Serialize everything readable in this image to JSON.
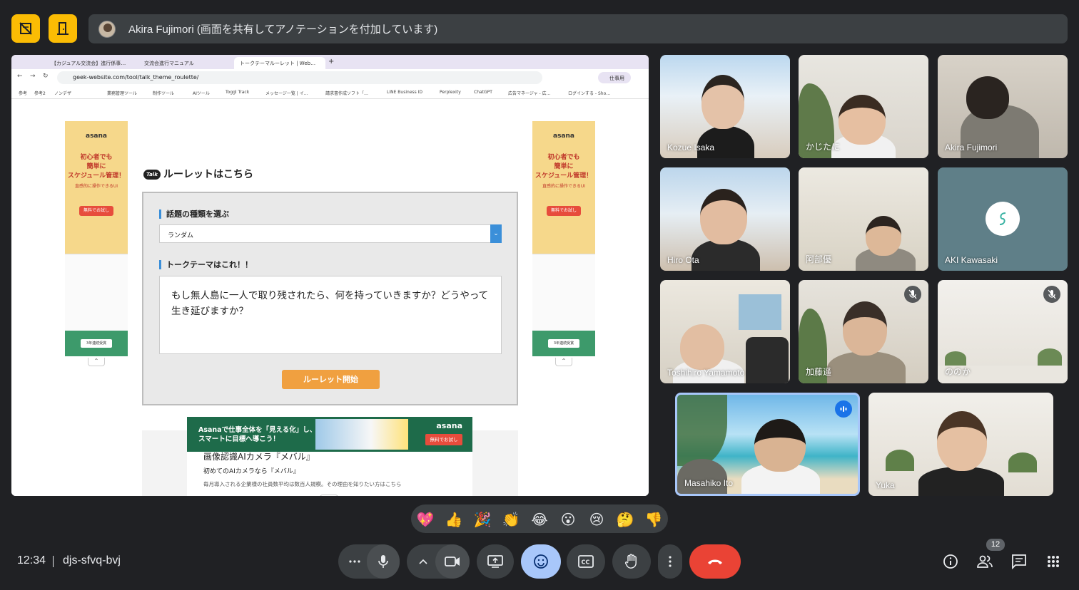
{
  "presenter": {
    "label": "Akira Fujimori (画面を共有してアノテーションを付加しています)"
  },
  "browser": {
    "tabs": [
      "【カジュアル交流会】進行係事…",
      "交流会進行マニュアル",
      "トークテーマルーレット | Web…"
    ],
    "url": "geek-website.com/tool/talk_theme_roulette/",
    "profile": "仕事用",
    "bookmarks": [
      "参考",
      "参考2",
      "ノンデザ",
      "業務管理ツール",
      "制作ツール",
      "AIツール",
      "Toggl Track",
      "メッセージ一覧 | イ…",
      "請求書作成ソフト「…",
      "LINE Business ID",
      "Perplexity",
      "ChatGPT",
      "広告マネージャ - 広…",
      "ログインする - Sho…"
    ]
  },
  "page": {
    "logo_text": "Talk",
    "title": "ルーレットはこちら",
    "topic_label": "話題の種類を選ぶ",
    "topic_value": "ランダム",
    "theme_label": "トークテーマはこれ！！",
    "theme_text": "もし無人島に一人で取り残されたら、何を持っていきますか？どうやって生き延びますか？",
    "start_button": "ルーレット開始"
  },
  "side_ad": {
    "brand": "asana",
    "headline_1": "初心者でも",
    "headline_2": "簡単に",
    "headline_3": "スケジュール管理！",
    "sub": "直感的に操作できるUI",
    "cta": "無料でお試し",
    "badge": "3年連続受賞"
  },
  "bottom_ad": {
    "title": "画像認識AIカメラ『メバル』",
    "subtitle": "初めてのAIカメラなら『メバル』",
    "desc": "毎月導入される企業様の社員数平均は数百人規模。その理由を知りたい方はこちら",
    "banner_line1": "Asanaで仕事全体を「見える化」し、",
    "banner_line2": "スマートに目標へ導こう！",
    "banner_brand": "asana",
    "banner_cta": "無料でお試し"
  },
  "participants": [
    {
      "name": "Kozue Isaka",
      "muted": false
    },
    {
      "name": "かじたに",
      "muted": false
    },
    {
      "name": "Akira Fujimori",
      "muted": false
    },
    {
      "name": "Hiro Ota",
      "muted": false
    },
    {
      "name": "阿部優",
      "muted": false
    },
    {
      "name": "AKI Kawasaki",
      "muted": false
    },
    {
      "name": "Toshihiro Yamamoto",
      "muted": false
    },
    {
      "name": "加藤遥",
      "muted": true
    },
    {
      "name": "ののか",
      "muted": true
    },
    {
      "name": "Masahiko Ito",
      "muted": false,
      "speaking": true
    },
    {
      "name": "Yuka",
      "muted": false
    }
  ],
  "reactions": [
    "💖",
    "👍",
    "🎉",
    "👏",
    "😂",
    "😮",
    "😢",
    "🤔",
    "👎"
  ],
  "footer": {
    "time": "12:34",
    "meeting_code": "djs-sfvq-bvj",
    "participant_count": "12"
  },
  "colors": {
    "background": "#202124",
    "control": "#3c4043",
    "accent_yellow": "#fbbc04",
    "hangup_red": "#ea4335",
    "active_blue": "#a8c7fa"
  }
}
